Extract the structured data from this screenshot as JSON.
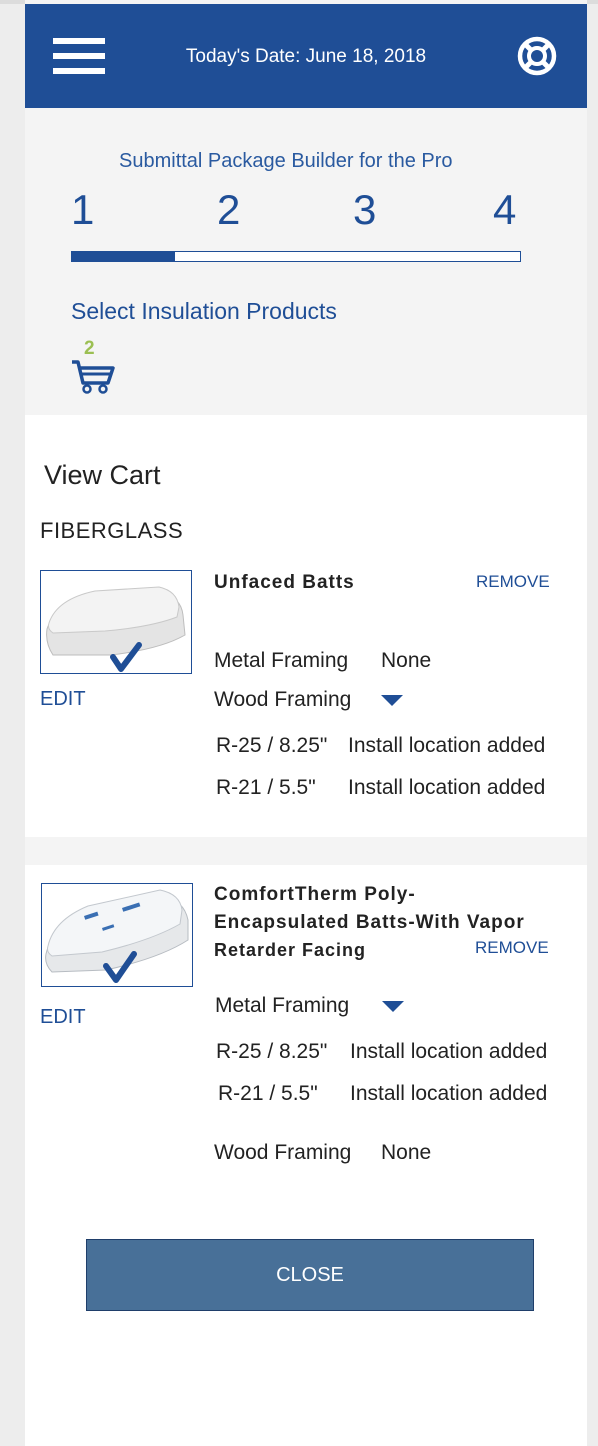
{
  "header": {
    "date_text": "Today's Date: June 18, 2018"
  },
  "builder": {
    "title": "Submittal Package Builder for the Pro",
    "steps": [
      "1",
      "2",
      "3",
      "4"
    ],
    "progress": 0.23,
    "section_title": "Select Insulation Products",
    "cart_count": "2"
  },
  "cart": {
    "heading": "View Cart",
    "category": "FIBERGLASS",
    "items": [
      {
        "name": "Unfaced Batts",
        "remove_label": "REMOVE",
        "edit_label": "EDIT",
        "metal_label": "Metal Framing",
        "metal_value": "None",
        "wood_label": "Wood Framing",
        "rows": [
          {
            "r_value": "R-25 / 8.25\"",
            "status": "Install location added"
          },
          {
            "r_value": "R-21 / 5.5\"",
            "status": "Install location added"
          }
        ]
      },
      {
        "name_line1": "ComfortTherm Poly-",
        "name_line2": "Encapsulated Batts-With Vapor",
        "name_line3": "Retarder Facing",
        "remove_label": "REMOVE",
        "edit_label": "EDIT",
        "metal_label": "Metal Framing",
        "rows": [
          {
            "r_value": "R-25 / 8.25\"",
            "status": "Install location added"
          },
          {
            "r_value": "R-21 / 5.5\"",
            "status": "Install location added"
          }
        ],
        "wood_label": "Wood Framing",
        "wood_value": "None"
      }
    ],
    "close_label": "CLOSE"
  },
  "colors": {
    "primary": "#1f4e96",
    "button": "#487098",
    "accent_green": "#9bbf52"
  }
}
